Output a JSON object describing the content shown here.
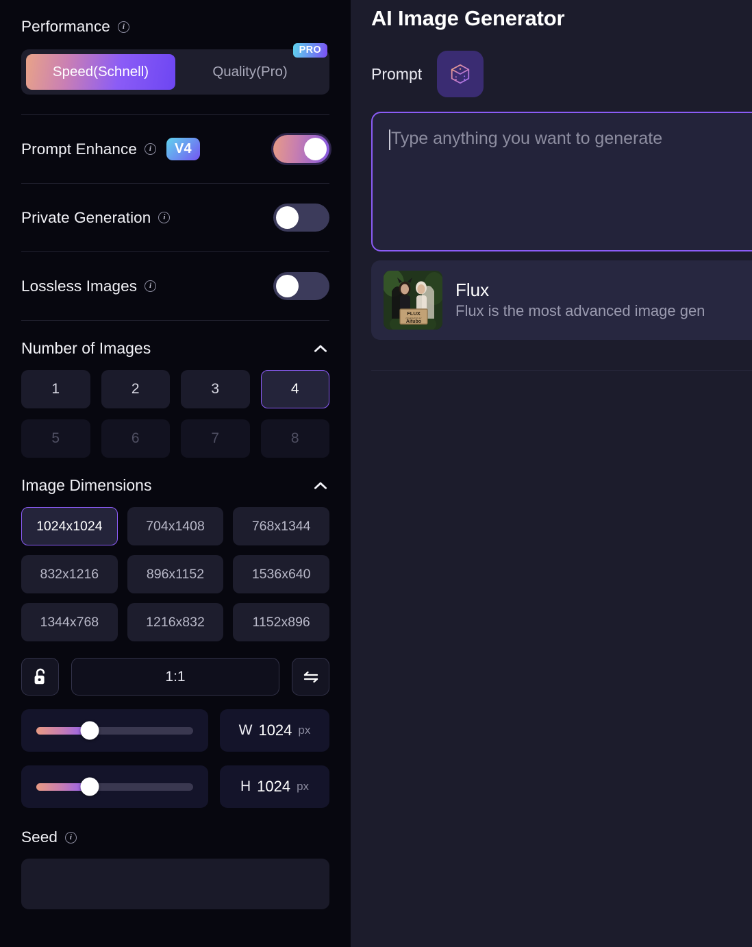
{
  "sidebar": {
    "performance": {
      "label": "Performance",
      "info_icon": "info-icon",
      "options": [
        {
          "label": "Speed(Schnell)",
          "selected": true,
          "badge": null
        },
        {
          "label": "Quality(Pro)",
          "selected": false,
          "badge": "PRO"
        }
      ]
    },
    "prompt_enhance": {
      "label": "Prompt Enhance",
      "badge": "V4",
      "enabled": true
    },
    "private_generation": {
      "label": "Private Generation",
      "enabled": false
    },
    "lossless_images": {
      "label": "Lossless Images",
      "enabled": false
    },
    "number_of_images": {
      "title": "Number of Images",
      "collapse_icon": "chevron-up-icon",
      "selected": "4",
      "options": [
        {
          "label": "1",
          "disabled": false
        },
        {
          "label": "2",
          "disabled": false
        },
        {
          "label": "3",
          "disabled": false
        },
        {
          "label": "4",
          "disabled": false
        },
        {
          "label": "5",
          "disabled": true
        },
        {
          "label": "6",
          "disabled": true
        },
        {
          "label": "7",
          "disabled": true
        },
        {
          "label": "8",
          "disabled": true
        }
      ]
    },
    "image_dimensions": {
      "title": "Image Dimensions",
      "collapse_icon": "chevron-up-icon",
      "selected": "1024x1024",
      "options": [
        "1024x1024",
        "704x1408",
        "768x1344",
        "832x1216",
        "896x1152",
        "1536x640",
        "1344x768",
        "1216x832",
        "1152x896"
      ],
      "lock_icon": "unlock-icon",
      "aspect_ratio": "1:1",
      "swap_icon": "swap-icon",
      "width": {
        "axis": "W",
        "value": "1024",
        "unit": "px",
        "slider_pct": 34
      },
      "height": {
        "axis": "H",
        "value": "1024",
        "unit": "px",
        "slider_pct": 34
      }
    },
    "seed": {
      "label": "Seed",
      "value": ""
    }
  },
  "main": {
    "title": "AI Image Generator",
    "prompt_label": "Prompt",
    "dice_icon": "dice-icon",
    "prompt_placeholder": "Type anything you want to generate",
    "prompt_value": "",
    "model": {
      "name": "Flux",
      "description": "Flux is the most advanced image gen",
      "thumbnail_sign_line1": "FLUX",
      "thumbnail_sign_line2": "Aitubo"
    }
  },
  "colors": {
    "accent": "#8b5cf6",
    "sidebar_bg": "#07070f",
    "panel_bg": "#1c1c2c",
    "gradient_start": "#e89a83",
    "gradient_end": "#6d46f2"
  }
}
